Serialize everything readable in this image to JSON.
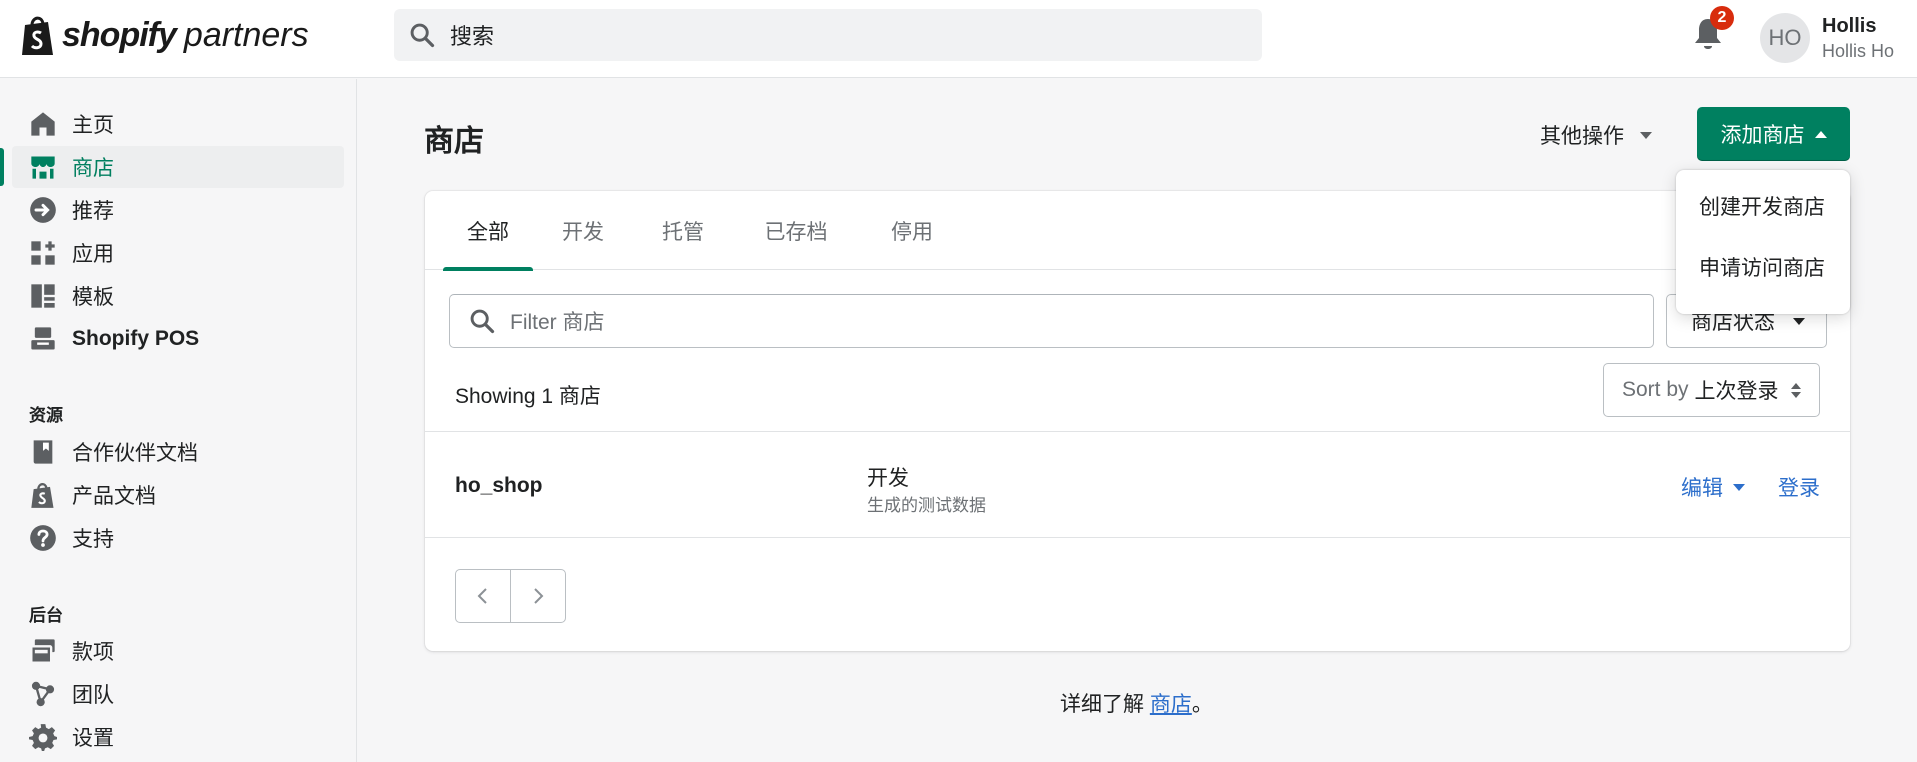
{
  "header": {
    "brand": "shopify",
    "brand_sub": "partners",
    "search_placeholder": "搜索",
    "notification_count": "2",
    "user_initials": "HO",
    "user_name": "Hollis",
    "user_subtitle": "Hollis Ho"
  },
  "sidebar": {
    "items": [
      {
        "label": "主页",
        "icon": "home-icon"
      },
      {
        "label": "商店",
        "icon": "store-icon",
        "active": true
      },
      {
        "label": "推荐",
        "icon": "referral-icon"
      },
      {
        "label": "应用",
        "icon": "apps-icon"
      },
      {
        "label": "模板",
        "icon": "theme-icon"
      },
      {
        "label": "Shopify POS",
        "icon": "pos-icon"
      }
    ],
    "resources_title": "资源",
    "resources": [
      {
        "label": "合作伙伴文档",
        "icon": "book-icon"
      },
      {
        "label": "产品文档",
        "icon": "shopify-bag-icon"
      },
      {
        "label": "支持",
        "icon": "question-icon"
      }
    ],
    "admin_title": "后台",
    "admin": [
      {
        "label": "款项",
        "icon": "payouts-icon"
      },
      {
        "label": "团队",
        "icon": "team-icon"
      },
      {
        "label": "设置",
        "icon": "gear-icon"
      }
    ]
  },
  "main": {
    "title": "商店",
    "more_actions": "其他操作",
    "add_store": "添加商店",
    "dropdown": [
      "创建开发商店",
      "申请访问商店"
    ],
    "tabs": [
      "全部",
      "开发",
      "托管",
      "已存档",
      "停用"
    ],
    "filter_placeholder": "Filter 商店",
    "status_filter": "商店状态",
    "showing": "Showing 1 商店",
    "sort_prefix": "Sort by",
    "sort_value": "上次登录",
    "rows": [
      {
        "name": "ho_shop",
        "type": "开发",
        "note": "生成的测试数据",
        "edit": "编辑",
        "login": "登录"
      }
    ],
    "footer_text": "详细了解 ",
    "footer_link": "商店",
    "footer_end": "。"
  },
  "colors": {
    "accent": "#008060",
    "link": "#2c6ecb",
    "badge": "#d82c0d"
  }
}
